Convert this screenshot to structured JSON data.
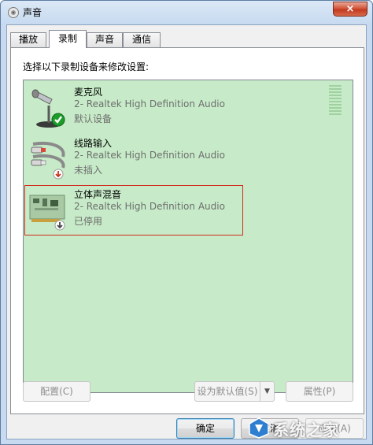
{
  "window": {
    "title": "声音",
    "close_label": "×"
  },
  "tabs": [
    {
      "label": "播放",
      "active": false
    },
    {
      "label": "录制",
      "active": true
    },
    {
      "label": "声音",
      "active": false
    },
    {
      "label": "通信",
      "active": false
    }
  ],
  "instructions": "选择以下录制设备来修改设置:",
  "devices": [
    {
      "name": "麦克风",
      "driver": "2- Realtek High Definition Audio",
      "status": "默认设备",
      "icon": "microphone-icon",
      "badge": "check-badge-icon"
    },
    {
      "name": "线路输入",
      "driver": "2- Realtek High Definition Audio",
      "status": "未插入",
      "icon": "line-in-cable-icon",
      "badge": "unplugged-badge-icon"
    },
    {
      "name": "立体声混音",
      "driver": "2- Realtek High Definition Audio",
      "status": "已停用",
      "icon": "sound-card-icon",
      "badge": "disabled-badge-icon",
      "highlighted": true
    }
  ],
  "buttons": {
    "configure": "配置(C)",
    "set_default": "设为默认值(S)",
    "properties": "属性(P)",
    "ok": "确定",
    "cancel": "取消",
    "apply": "应用(A)"
  },
  "watermark": {
    "text": "系统之家"
  },
  "colors": {
    "list_background": "#c7ebc8",
    "highlight_border": "#d22a1e",
    "close_button": "#c13a1f"
  }
}
